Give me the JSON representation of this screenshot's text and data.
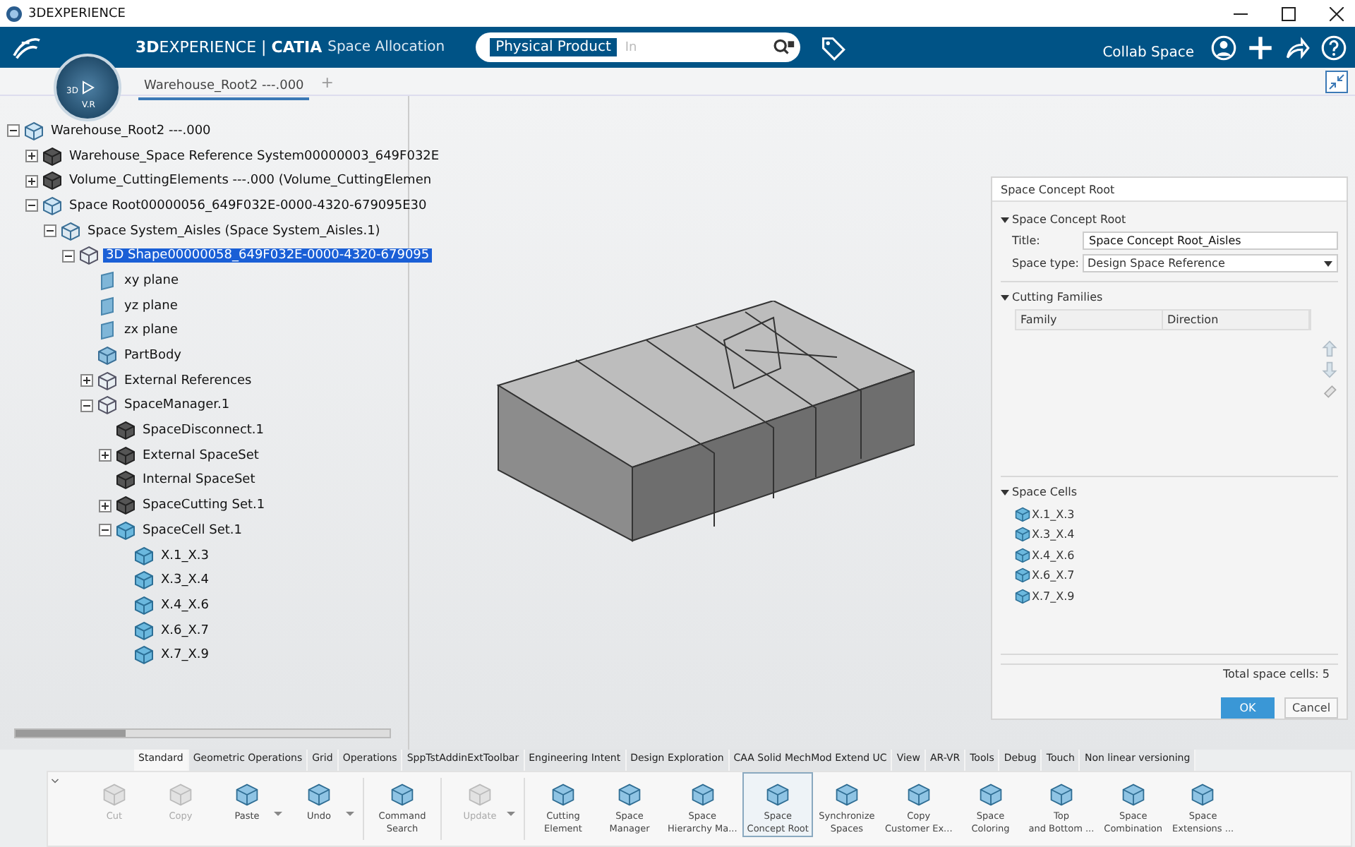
{
  "window": {
    "title": "3DEXPERIENCE"
  },
  "header": {
    "brand": "**3D**EXPERIENCE | **CATIA**",
    "app": "Space Allocation",
    "compass": {
      "left": "3D",
      "bottom": "V.R"
    },
    "search": {
      "scope": "Physical Product",
      "placeholder": "In"
    },
    "collab_space": "Collab Space"
  },
  "doc_tabs": [
    {
      "label": "Warehouse_Root2 ---.000",
      "selected": true
    }
  ],
  "doc_tab_add": "+",
  "tree": [
    {
      "label": "Warehouse_Root2 ---.000",
      "kind": "product",
      "expanded": true,
      "selected": false,
      "children": [
        {
          "label": "Warehouse_Space Reference System00000003_649F032E",
          "kind": "dark",
          "expanded": false,
          "selected": false
        },
        {
          "label": "Volume_CuttingElements ---.000 (Volume_CuttingElemen",
          "kind": "dark",
          "expanded": false,
          "selected": false
        },
        {
          "label": "Space Root00000056_649F032E-0000-4320-679095E30",
          "kind": "product",
          "expanded": true,
          "selected": false,
          "children": [
            {
              "label": "Space System_Aisles (Space System_Aisles.1)",
              "kind": "system",
              "expanded": true,
              "selected": false,
              "children": [
                {
                  "label": "3D Shape00000058_649F032E-0000-4320-679095",
                  "kind": "shape",
                  "expanded": true,
                  "selected": true,
                  "children": [
                    {
                      "label": "xy plane",
                      "kind": "plane",
                      "selected": false
                    },
                    {
                      "label": "yz plane",
                      "kind": "plane",
                      "selected": false
                    },
                    {
                      "label": "zx plane",
                      "kind": "plane",
                      "selected": false
                    },
                    {
                      "label": "PartBody",
                      "kind": "body",
                      "selected": false
                    },
                    {
                      "label": "External References",
                      "kind": "shape",
                      "expanded": false,
                      "selected": false
                    },
                    {
                      "label": "SpaceManager.1",
                      "kind": "shape",
                      "expanded": true,
                      "selected": false,
                      "children": [
                        {
                          "label": "SpaceDisconnect.1",
                          "kind": "dark",
                          "selected": false
                        },
                        {
                          "label": "External SpaceSet",
                          "kind": "dark",
                          "expanded": false,
                          "selected": false
                        },
                        {
                          "label": "Internal SpaceSet",
                          "kind": "dark",
                          "selected": false
                        },
                        {
                          "label": "SpaceCutting Set.1",
                          "kind": "dark",
                          "expanded": false,
                          "selected": false
                        },
                        {
                          "label": "SpaceCell Set.1",
                          "kind": "cell",
                          "expanded": true,
                          "selected": false,
                          "children": [
                            {
                              "label": "X.1_X.3",
                              "kind": "cell",
                              "selected": false
                            },
                            {
                              "label": "X.3_X.4",
                              "kind": "cell",
                              "selected": false
                            },
                            {
                              "label": "X.4_X.6",
                              "kind": "cell",
                              "selected": false
                            },
                            {
                              "label": "X.6_X.7",
                              "kind": "cell",
                              "selected": false
                            },
                            {
                              "label": "X.7_X.9",
                              "kind": "cell",
                              "selected": false
                            }
                          ]
                        }
                      ]
                    }
                  ]
                }
              ]
            }
          ]
        }
      ]
    }
  ],
  "dialog": {
    "title": "Space Concept Root",
    "sections": [
      {
        "kind": "form",
        "title": "Space Concept Root",
        "expanded": true,
        "fields": [
          {
            "label": "Title:",
            "value": "Space Concept Root_Aisles",
            "kind": "text"
          },
          {
            "label": "Space type:",
            "value": "Design Space Reference",
            "kind": "dropdown"
          }
        ]
      },
      {
        "kind": "table",
        "title": "Cutting Families",
        "expanded": true,
        "columns": [
          "Family",
          "Direction"
        ]
      },
      {
        "kind": "list",
        "title": "Space Cells",
        "expanded": true,
        "items": [
          "X.1_X.3",
          "X.3_X.4",
          "X.4_X.6",
          "X.6_X.7",
          "X.7_X.9"
        ]
      }
    ],
    "total": "Total space cells: 5",
    "buttons": [
      {
        "label": "OK",
        "kind": "primary"
      },
      {
        "label": "Cancel",
        "kind": "secondary"
      }
    ]
  },
  "toolbar_tabs": [
    {
      "label": "Standard",
      "selected": true
    },
    {
      "label": "Geometric Operations",
      "selected": false
    },
    {
      "label": "Grid",
      "selected": false
    },
    {
      "label": "Operations",
      "selected": false
    },
    {
      "label": "SppTstAddinExtToolbar",
      "selected": false
    },
    {
      "label": "Engineering Intent",
      "selected": false
    },
    {
      "label": "Design Exploration",
      "selected": false
    },
    {
      "label": "CAA Solid MechMod Extend UC",
      "selected": false
    },
    {
      "label": "View",
      "selected": false
    },
    {
      "label": "AR-VR",
      "selected": false
    },
    {
      "label": "Tools",
      "selected": false
    },
    {
      "label": "Debug",
      "selected": false
    },
    {
      "label": "Touch",
      "selected": false
    },
    {
      "label": "Non linear versioning",
      "selected": false
    }
  ],
  "command_groups": [
    [
      {
        "label": "Cut",
        "disabled": true,
        "dropdown": false,
        "selected": false
      },
      {
        "label": "Copy",
        "disabled": true,
        "dropdown": false,
        "selected": false
      },
      {
        "label": "Paste",
        "disabled": false,
        "dropdown": true,
        "selected": false
      },
      {
        "label": "Undo",
        "disabled": false,
        "dropdown": true,
        "selected": false
      }
    ],
    [
      {
        "label": "Command\nSearch",
        "disabled": false,
        "dropdown": false,
        "selected": false
      }
    ],
    [
      {
        "label": "Update",
        "disabled": true,
        "dropdown": true,
        "selected": false
      }
    ],
    [
      {
        "label": "Cutting\nElement",
        "disabled": false,
        "dropdown": false,
        "selected": false
      },
      {
        "label": "Space\nManager",
        "disabled": false,
        "dropdown": false,
        "selected": false
      },
      {
        "label": "Space\nHierarchy Ma...",
        "disabled": false,
        "dropdown": false,
        "selected": false
      },
      {
        "label": "Space\nConcept Root",
        "disabled": false,
        "dropdown": false,
        "selected": true
      },
      {
        "label": "Synchronize\nSpaces",
        "disabled": false,
        "dropdown": false,
        "selected": false
      },
      {
        "label": "Copy\nCustomer Ex...",
        "disabled": false,
        "dropdown": false,
        "selected": false
      },
      {
        "label": "Space\nColoring",
        "disabled": false,
        "dropdown": false,
        "selected": false
      },
      {
        "label": "Top\nand Bottom ...",
        "disabled": false,
        "dropdown": false,
        "selected": false
      },
      {
        "label": "Space\nCombination",
        "disabled": false,
        "dropdown": false,
        "selected": false
      },
      {
        "label": "Space\nExtensions ...",
        "disabled": false,
        "dropdown": false,
        "selected": false
      }
    ]
  ]
}
